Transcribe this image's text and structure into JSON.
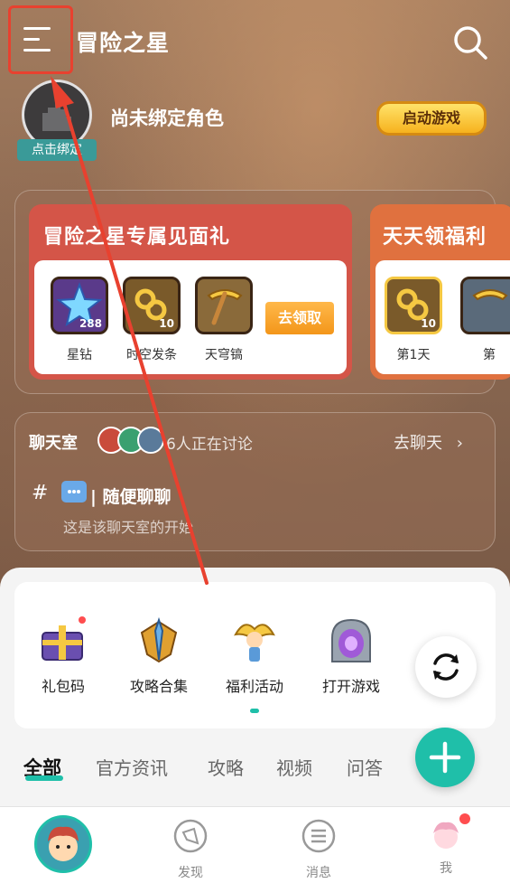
{
  "header": {
    "title": "冒险之星"
  },
  "profile": {
    "name": "尚未绑定角色",
    "bind_tag": "点击绑定",
    "start_button": "启动游戏"
  },
  "gift_card": {
    "title": "冒险之星专属见面礼",
    "items": [
      {
        "label": "星钻",
        "count": "288",
        "icon": "star-diamond-icon"
      },
      {
        "label": "时空发条",
        "count": "10",
        "icon": "clockwork-icon"
      },
      {
        "label": "天穹镐",
        "count": "",
        "icon": "pickaxe-icon"
      }
    ],
    "claim_button": "去领取"
  },
  "welfare_card": {
    "title": "天天领福利",
    "items": [
      {
        "label": "第1天",
        "count": "10",
        "icon": "clockwork-icon"
      },
      {
        "label": "第",
        "count": "",
        "icon": "pickaxe-icon"
      }
    ]
  },
  "chat": {
    "title": "聊天室",
    "online_text": "6人正在讨论",
    "go_chat": "去聊天",
    "channel_name": "| 随便聊聊",
    "channel_desc": "这是该聊天室的开始"
  },
  "tools": [
    {
      "label": "礼包码",
      "icon": "gift-box-icon"
    },
    {
      "label": "攻略合集",
      "icon": "sword-shield-icon"
    },
    {
      "label": "福利活动",
      "icon": "fairy-character-icon"
    },
    {
      "label": "打开游戏",
      "icon": "portal-icon"
    }
  ],
  "tabs": [
    "全部",
    "官方资讯",
    "攻略",
    "视频",
    "问答"
  ],
  "bottom_nav": [
    {
      "label": "",
      "icon": "game-avatar-icon"
    },
    {
      "label": "发现",
      "icon": "compass-icon"
    },
    {
      "label": "消息",
      "icon": "message-icon"
    },
    {
      "label": "我",
      "icon": "user-avatar-icon"
    }
  ],
  "colors": {
    "accent": "#1fbfa9",
    "highlight": "#e8412f",
    "gift_card": "#d45548",
    "welfare_card": "#e0713f"
  }
}
